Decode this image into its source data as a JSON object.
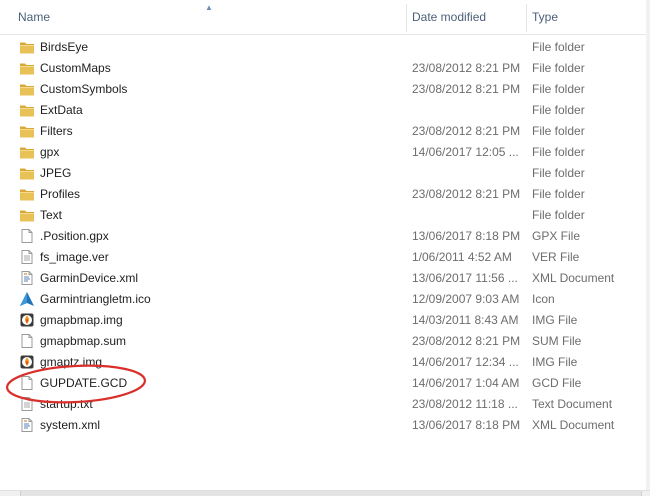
{
  "columns": {
    "name": "Name",
    "date": "Date modified",
    "type": "Type"
  },
  "files": [
    {
      "name": "BirdsEye",
      "date": "",
      "type": "File folder",
      "icon": "folder-icon"
    },
    {
      "name": "CustomMaps",
      "date": "23/08/2012 8:21 PM",
      "type": "File folder",
      "icon": "folder-icon"
    },
    {
      "name": "CustomSymbols",
      "date": "23/08/2012 8:21 PM",
      "type": "File folder",
      "icon": "folder-icon"
    },
    {
      "name": "ExtData",
      "date": "",
      "type": "File folder",
      "icon": "folder-icon"
    },
    {
      "name": "Filters",
      "date": "23/08/2012 8:21 PM",
      "type": "File folder",
      "icon": "folder-icon"
    },
    {
      "name": "gpx",
      "date": "14/06/2017 12:05 ...",
      "type": "File folder",
      "icon": "folder-icon"
    },
    {
      "name": "JPEG",
      "date": "",
      "type": "File folder",
      "icon": "folder-icon"
    },
    {
      "name": "Profiles",
      "date": "23/08/2012 8:21 PM",
      "type": "File folder",
      "icon": "folder-icon"
    },
    {
      "name": "Text",
      "date": "",
      "type": "File folder",
      "icon": "folder-icon"
    },
    {
      "name": ".Position.gpx",
      "date": "13/06/2017 8:18 PM",
      "type": "GPX File",
      "icon": "file-icon"
    },
    {
      "name": "fs_image.ver",
      "date": "1/06/2011 4:52 AM",
      "type": "VER File",
      "icon": "text-file-icon"
    },
    {
      "name": "GarminDevice.xml",
      "date": "13/06/2017 11:56 ...",
      "type": "XML Document",
      "icon": "xml-file-icon"
    },
    {
      "name": "Garmintriangletm.ico",
      "date": "12/09/2007 9:03 AM",
      "type": "Icon",
      "icon": "garmin-triangle-icon"
    },
    {
      "name": "gmapbmap.img",
      "date": "14/03/2011 8:43 AM",
      "type": "IMG File",
      "icon": "img-file-icon"
    },
    {
      "name": "gmapbmap.sum",
      "date": "23/08/2012 8:21 PM",
      "type": "SUM File",
      "icon": "file-icon"
    },
    {
      "name": "gmaptz.img",
      "date": "14/06/2017 12:34 ...",
      "type": "IMG File",
      "icon": "img-file-icon"
    },
    {
      "name": "GUPDATE.GCD",
      "date": "14/06/2017 1:04 AM",
      "type": "GCD File",
      "icon": "file-icon"
    },
    {
      "name": "startup.txt",
      "date": "23/08/2012 11:18 ...",
      "type": "Text Document",
      "icon": "text-file-icon"
    },
    {
      "name": "system.xml",
      "date": "13/06/2017 8:18 PM",
      "type": "XML Document",
      "icon": "xml-file-icon"
    }
  ],
  "colors": {
    "annotation": "#d9302c",
    "folder": "#e8c257",
    "header_text": "#4c607a"
  }
}
